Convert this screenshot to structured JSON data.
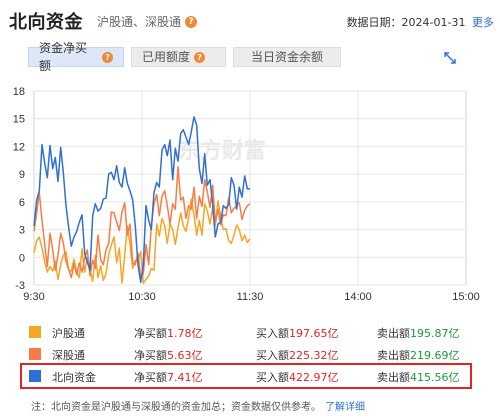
{
  "header": {
    "title": "北向资金",
    "subtitle": "沪股通、深股通",
    "date_label": "数据日期：2024-01-31",
    "more": "更多"
  },
  "tabs": [
    {
      "label": "资金净买额",
      "active": true
    },
    {
      "label": "已用额度",
      "active": false
    },
    {
      "label": "当日资金余额",
      "active": false
    }
  ],
  "watermark": "东方财富",
  "colors": {
    "sh": "#f5a623",
    "sz": "#fa7b45",
    "north": "#2f6fd6"
  },
  "chart_data": {
    "type": "line",
    "x_ticks": [
      "9:30",
      "10:30",
      "11:30",
      "14:00",
      "15:00"
    ],
    "y_ticks": [
      "18",
      "15",
      "12",
      "9",
      "6",
      "3",
      "0",
      "-3"
    ],
    "ylim": [
      -3,
      18
    ],
    "grid": true,
    "series": [
      {
        "name": "沪股通",
        "color": "#f5a623",
        "values": [
          0.5,
          1.8,
          2.2,
          1.0,
          -0.5,
          -1.6,
          -1.0,
          -1.5,
          -0.4,
          -2.4,
          -0.8,
          0.2,
          0.6,
          -1.4,
          -1.5,
          -0.2,
          -1.6,
          -2.2,
          0.9,
          -1.6,
          0.0,
          -1.4,
          -2.6,
          0.2,
          -2.2,
          -0.9,
          -2.5,
          -1.8,
          0.3,
          1.3,
          2.2,
          -0.6,
          1.0,
          -2.8,
          0.2,
          3.4,
          1.4,
          -1.2,
          -0.3,
          -0.4,
          0.6,
          -2.8,
          -2.4,
          -2.0,
          -1.2,
          -1.4,
          3.6,
          2.3,
          4.2,
          3.4,
          1.5,
          3.6,
          3.0,
          1.4,
          3.2,
          4.8,
          3.4,
          2.8,
          4.3,
          6.3,
          4.6,
          2.4,
          4.0,
          2.4,
          5.8,
          5.0,
          3.6,
          5.4,
          3.4,
          6.1,
          4.4,
          3.0,
          3.1,
          1.8,
          1.5,
          2.4,
          3.5,
          3.0,
          1.8,
          2.4,
          1.6,
          2.0
        ]
      },
      {
        "name": "深股通",
        "color": "#fa7b45",
        "values": [
          2.8,
          4.8,
          7.0,
          4.0,
          1.4,
          -1.0,
          2.6,
          0.8,
          -1.4,
          0.2,
          2.6,
          1.6,
          -0.5,
          -1.3,
          -2.2,
          -0.7,
          -1.9,
          -0.6,
          -1.6,
          -0.1,
          0.8,
          -2.0,
          -0.3,
          -1.2,
          2.4,
          -0.3,
          -0.8,
          0.8,
          1.5,
          4.9,
          4.8,
          3.8,
          2.9,
          4.9,
          5.9,
          2.4,
          3.6,
          -0.6,
          -0.8,
          0.4,
          -2.2,
          -1.8,
          1.4,
          -0.8,
          3.4,
          5.8,
          6.8,
          4.5,
          6.6,
          7.2,
          5.6,
          3.6,
          5.8,
          5.2,
          9.8,
          6.2,
          6.5,
          4.2,
          5.6,
          5.2,
          7.6,
          4.2,
          6.6,
          5.5,
          8.4,
          7.1,
          5.4,
          7.8,
          3.8,
          5.2,
          3.5,
          4.6,
          4.5,
          6.4,
          4.8,
          5.3,
          5.6,
          5.9,
          4.1,
          5.1,
          5.6,
          5.8
        ]
      },
      {
        "name": "北向资金",
        "color": "#2f6fd6",
        "values": [
          3.4,
          6.2,
          7.2,
          12.2,
          10.2,
          8.6,
          12.1,
          9.6,
          10.8,
          8.2,
          11.9,
          9.2,
          5.6,
          3.2,
          1.2,
          2.2,
          2.8,
          3.8,
          4.6,
          0.4,
          -0.5,
          -1.4,
          4.5,
          5.8,
          5.0,
          5.3,
          6.3,
          6.4,
          9.0,
          9.2,
          8.4,
          9.9,
          8.1,
          7.6,
          9.7,
          8.0,
          7.2,
          6.2,
          3.4,
          -0.8,
          -2.7,
          -0.8,
          5.6,
          4.0,
          3.0,
          7.0,
          8.1,
          7.6,
          11.6,
          12.2,
          11.0,
          12.7,
          8.4,
          11.8,
          10.4,
          13.4,
          13.8,
          13.0,
          12.2,
          13.6,
          15.2,
          14.3,
          9.6,
          8.0,
          11.2,
          7.8,
          8.4,
          5.7,
          2.2,
          3.6,
          3.8,
          5.6,
          5.3,
          5.7,
          8.6,
          7.8,
          5.2,
          7.6,
          6.5,
          8.8,
          7.4,
          7.4
        ]
      }
    ]
  },
  "legend": [
    {
      "name": "沪股通",
      "color": "#f5a623",
      "net_label": "净买额",
      "net": "1.78亿",
      "buy_label": "买入额",
      "buy": "197.65亿",
      "sell_label": "卖出额",
      "sell": "195.87亿",
      "highlight": false
    },
    {
      "name": "深股通",
      "color": "#fa7b45",
      "net_label": "净买额",
      "net": "5.63亿",
      "buy_label": "买入额",
      "buy": "225.32亿",
      "sell_label": "卖出额",
      "sell": "219.69亿",
      "highlight": false
    },
    {
      "name": "北向资金",
      "color": "#2f6fd6",
      "net_label": "净买额",
      "net": "7.41亿",
      "buy_label": "买入额",
      "buy": "422.97亿",
      "sell_label": "卖出额",
      "sell": "415.56亿",
      "highlight": true
    }
  ],
  "note": {
    "text": "注：北向资金是沪股通与深股通的资金加总；资金数据仅供参考。",
    "link": "了解详细"
  }
}
